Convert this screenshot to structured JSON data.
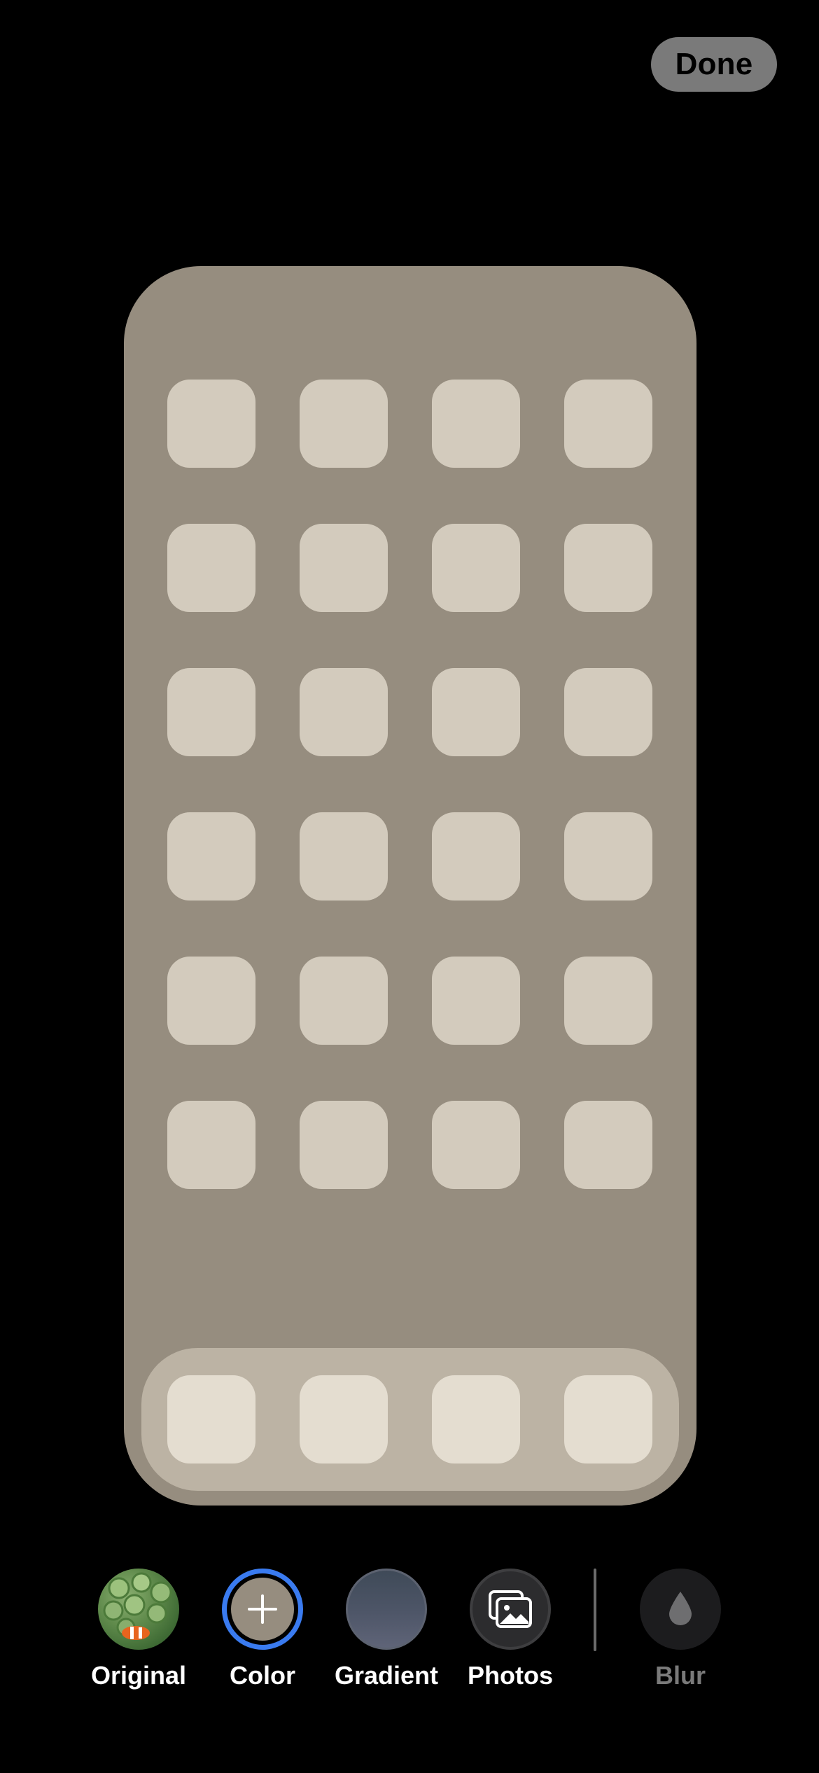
{
  "header": {
    "done_label": "Done"
  },
  "preview": {
    "background_color": "#968d7f",
    "icon_color": "#d3cbbd",
    "dock_color": "#bcb3a4",
    "dock_icon_color": "#e4ddd0",
    "icon_rows": 6,
    "icon_columns": 4,
    "dock_icon_count": 4
  },
  "bottom_bar": {
    "options": [
      {
        "label": "Original",
        "icon": "photo-thumbnail-icon"
      },
      {
        "label": "Color",
        "icon": "plus-icon",
        "selected": true
      },
      {
        "label": "Gradient",
        "icon": "gradient-swatch-icon"
      },
      {
        "label": "Photos",
        "icon": "photos-icon"
      },
      {
        "label": "Blur",
        "icon": "droplet-icon",
        "disabled": true
      }
    ],
    "selection_color": "#3a7bf0"
  }
}
